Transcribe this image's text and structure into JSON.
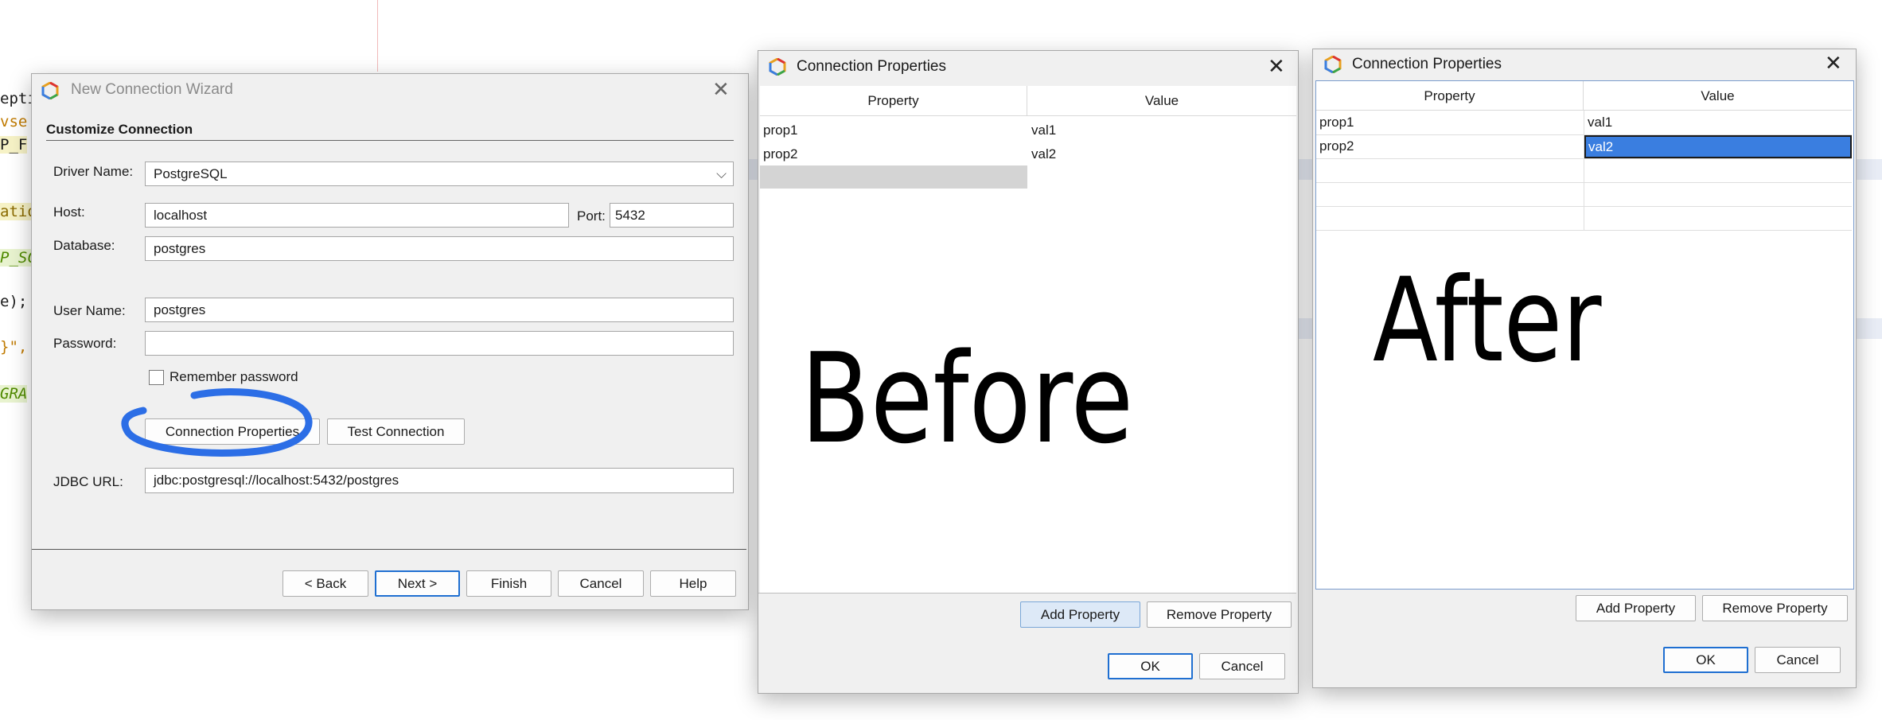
{
  "background": {
    "code_fragments": [
      "epti",
      "vse",
      "P_F",
      "atio",
      "P_SC",
      "e);",
      "}\",",
      "GRA"
    ]
  },
  "wizard": {
    "title": "New Connection Wizard",
    "section_heading": "Customize Connection",
    "driver_name_label": "Driver Name:",
    "driver_name_value": "PostgreSQL",
    "host_label": "Host:",
    "host_value": "localhost",
    "port_label": "Port:",
    "port_value": "5432",
    "database_label": "Database:",
    "database_value": "postgres",
    "user_name_label": "User Name:",
    "user_name_value": "postgres",
    "password_label": "Password:",
    "password_value": "",
    "remember_password_label": "Remember password",
    "remember_password_checked": false,
    "connection_properties_button": "Connection Properties",
    "test_connection_button": "Test Connection",
    "jdbc_url_label": "JDBC URL:",
    "jdbc_url_value": "jdbc:postgresql://localhost:5432/postgres",
    "buttons": {
      "back": "< Back",
      "next": "Next >",
      "finish": "Finish",
      "cancel": "Cancel",
      "help": "Help"
    }
  },
  "before_dialog": {
    "title": "Connection Properties",
    "columns": [
      "Property",
      "Value"
    ],
    "rows": [
      {
        "property": "prop1",
        "value": "val1"
      },
      {
        "property": "prop2",
        "value": "val2"
      }
    ],
    "caption": "Before",
    "add_property": "Add Property",
    "remove_property": "Remove Property",
    "ok": "OK",
    "cancel": "Cancel"
  },
  "after_dialog": {
    "title": "Connection Properties",
    "columns": [
      "Property",
      "Value"
    ],
    "rows": [
      {
        "property": "prop1",
        "value": "val1"
      },
      {
        "property": "prop2",
        "value": "val2"
      }
    ],
    "caption": "After",
    "add_property": "Add Property",
    "remove_property": "Remove Property",
    "ok": "OK",
    "cancel": "Cancel"
  },
  "colors": {
    "selection": "#3a7ee0",
    "annotation_stroke": "#2c6ee6",
    "focus_border": "#1f6fd1",
    "empty_row_gray": "#d4d4d4"
  }
}
